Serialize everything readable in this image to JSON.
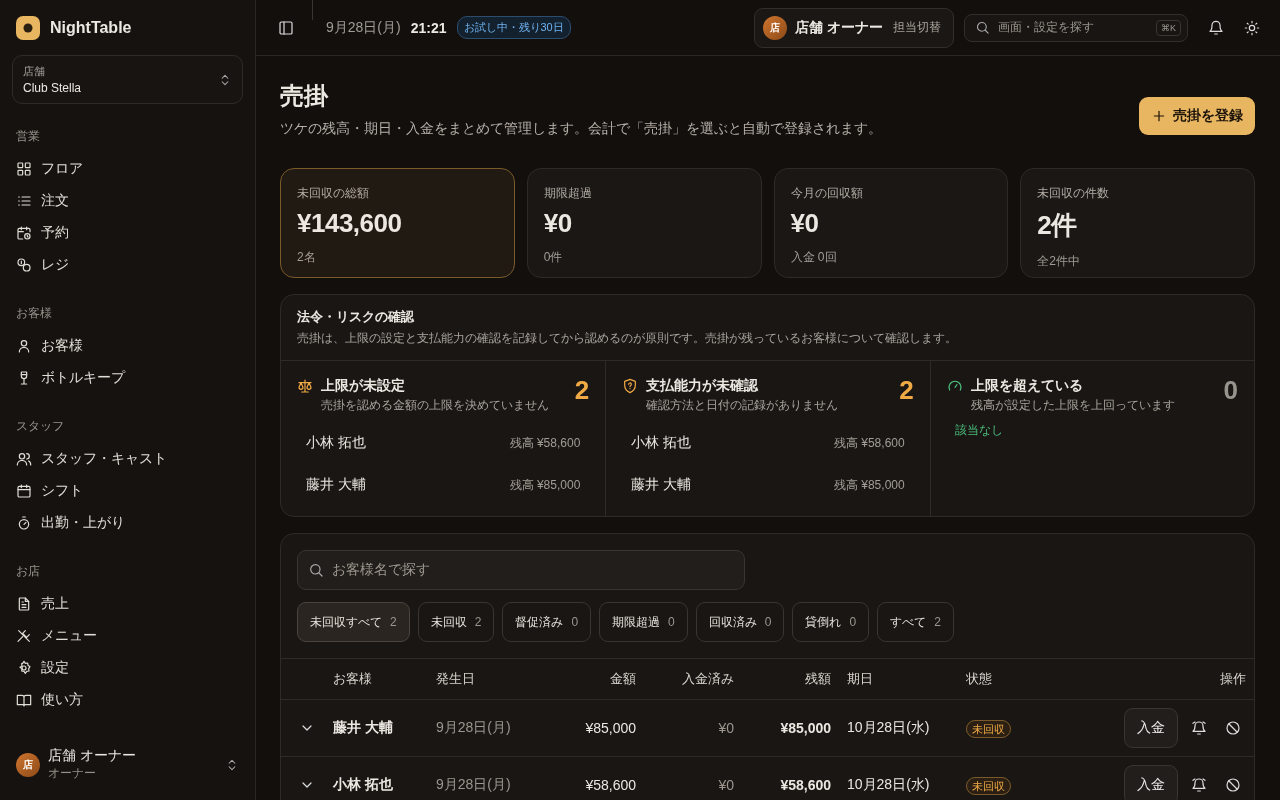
{
  "app": {
    "name": "NightTable"
  },
  "store_picker": {
    "label": "店舗",
    "value": "Club Stella"
  },
  "nav_sections": [
    {
      "title": "営業",
      "items": [
        {
          "label": "フロア",
          "selected": false
        },
        {
          "label": "注文",
          "selected": false
        },
        {
          "label": "予約",
          "selected": false
        },
        {
          "label": "レジ",
          "selected": false
        }
      ]
    },
    {
      "title": "お客様",
      "items": [
        {
          "label": "お客様",
          "selected": false
        },
        {
          "label": "ボトルキープ",
          "selected": false
        }
      ]
    },
    {
      "title": "スタッフ",
      "items": [
        {
          "label": "スタッフ・キャスト",
          "selected": false
        },
        {
          "label": "シフト",
          "selected": false
        },
        {
          "label": "出勤・上がり",
          "selected": false
        }
      ]
    },
    {
      "title": "お店",
      "items": [
        {
          "label": "売上",
          "selected": false
        },
        {
          "label": "メニュー",
          "selected": false
        },
        {
          "label": "設定",
          "selected": false
        },
        {
          "label": "使い方",
          "selected": false
        }
      ]
    }
  ],
  "sidebar_user": {
    "avatar": "店",
    "name": "店舗 オーナー",
    "role": "オーナー"
  },
  "topbar": {
    "date": "9月28日(月)",
    "time": "21:21",
    "trial_badge": "お試し中・残り30日",
    "staff": {
      "avatar": "店",
      "name": "店舗 オーナー",
      "switch_label": "担当切替"
    },
    "search": {
      "placeholder": "画面・設定を探す",
      "shortcut": "⌘K"
    }
  },
  "page": {
    "title": "売掛",
    "subtitle": "ツケの残高・期日・入金をまとめて管理します。会計で「売掛」を選ぶと自動で登録されます。",
    "primary_button": "売掛を登録"
  },
  "stats": [
    {
      "label": "未回収の総額",
      "value": "¥143,600",
      "note": "2名",
      "selected": true
    },
    {
      "label": "期限超過",
      "value": "¥0",
      "note": "0件",
      "selected": false
    },
    {
      "label": "今月の回収額",
      "value": "¥0",
      "note": "入金 0回",
      "selected": false
    },
    {
      "label": "未回収の件数",
      "value": "2件",
      "note": "全2件中",
      "selected": false
    }
  ],
  "risk_check": {
    "title": "法令・リスクの確認",
    "description": "売掛は、上限の設定と支払能力の確認を記録してから認めるのが原則です。売掛が残っているお客様について確認します。",
    "columns": [
      {
        "title": "上限が未設定",
        "description": "売掛を認める金額の上限を決めていません",
        "count": "2",
        "alert": true,
        "items": [
          {
            "name": "小林 拓也",
            "balance": "残高 ¥58,600"
          },
          {
            "name": "藤井 大輔",
            "balance": "残高 ¥85,000"
          }
        ]
      },
      {
        "title": "支払能力が未確認",
        "description": "確認方法と日付の記録がありません",
        "count": "2",
        "alert": true,
        "items": [
          {
            "name": "小林 拓也",
            "balance": "残高 ¥58,600"
          },
          {
            "name": "藤井 大輔",
            "balance": "残高 ¥85,000"
          }
        ]
      },
      {
        "title": "上限を超えている",
        "description": "残高が設定した上限を上回っています",
        "count": "0",
        "alert": false,
        "empty_text": "該当なし"
      }
    ]
  },
  "list": {
    "search": {
      "placeholder": "お客様名で探す"
    },
    "filters": [
      {
        "label": "未回収すべて",
        "count": "2",
        "selected": true
      },
      {
        "label": "未回収",
        "count": "2",
        "selected": false
      },
      {
        "label": "督促済み",
        "count": "0",
        "selected": false
      },
      {
        "label": "期限超過",
        "count": "0",
        "selected": false
      },
      {
        "label": "回収済み",
        "count": "0",
        "selected": false
      },
      {
        "label": "貸倒れ",
        "count": "0",
        "selected": false
      },
      {
        "label": "すべて",
        "count": "2",
        "selected": false
      }
    ],
    "table": {
      "columns": [
        "お客様",
        "発生日",
        "金額",
        "入金済み",
        "残額",
        "期日",
        "状態",
        "操作"
      ],
      "rows": [
        {
          "customer": "藤井 大輔",
          "date": "9月28日(月)",
          "amount": "¥85,000",
          "paid": "¥0",
          "remaining": "¥85,000",
          "due": "10月28日(水)",
          "status": "未回収",
          "action": "入金"
        },
        {
          "customer": "小林 拓也",
          "date": "9月28日(月)",
          "amount": "¥58,600",
          "paid": "¥0",
          "remaining": "¥58,600",
          "due": "10月28日(水)",
          "status": "未回収",
          "action": "入金"
        }
      ]
    }
  }
}
